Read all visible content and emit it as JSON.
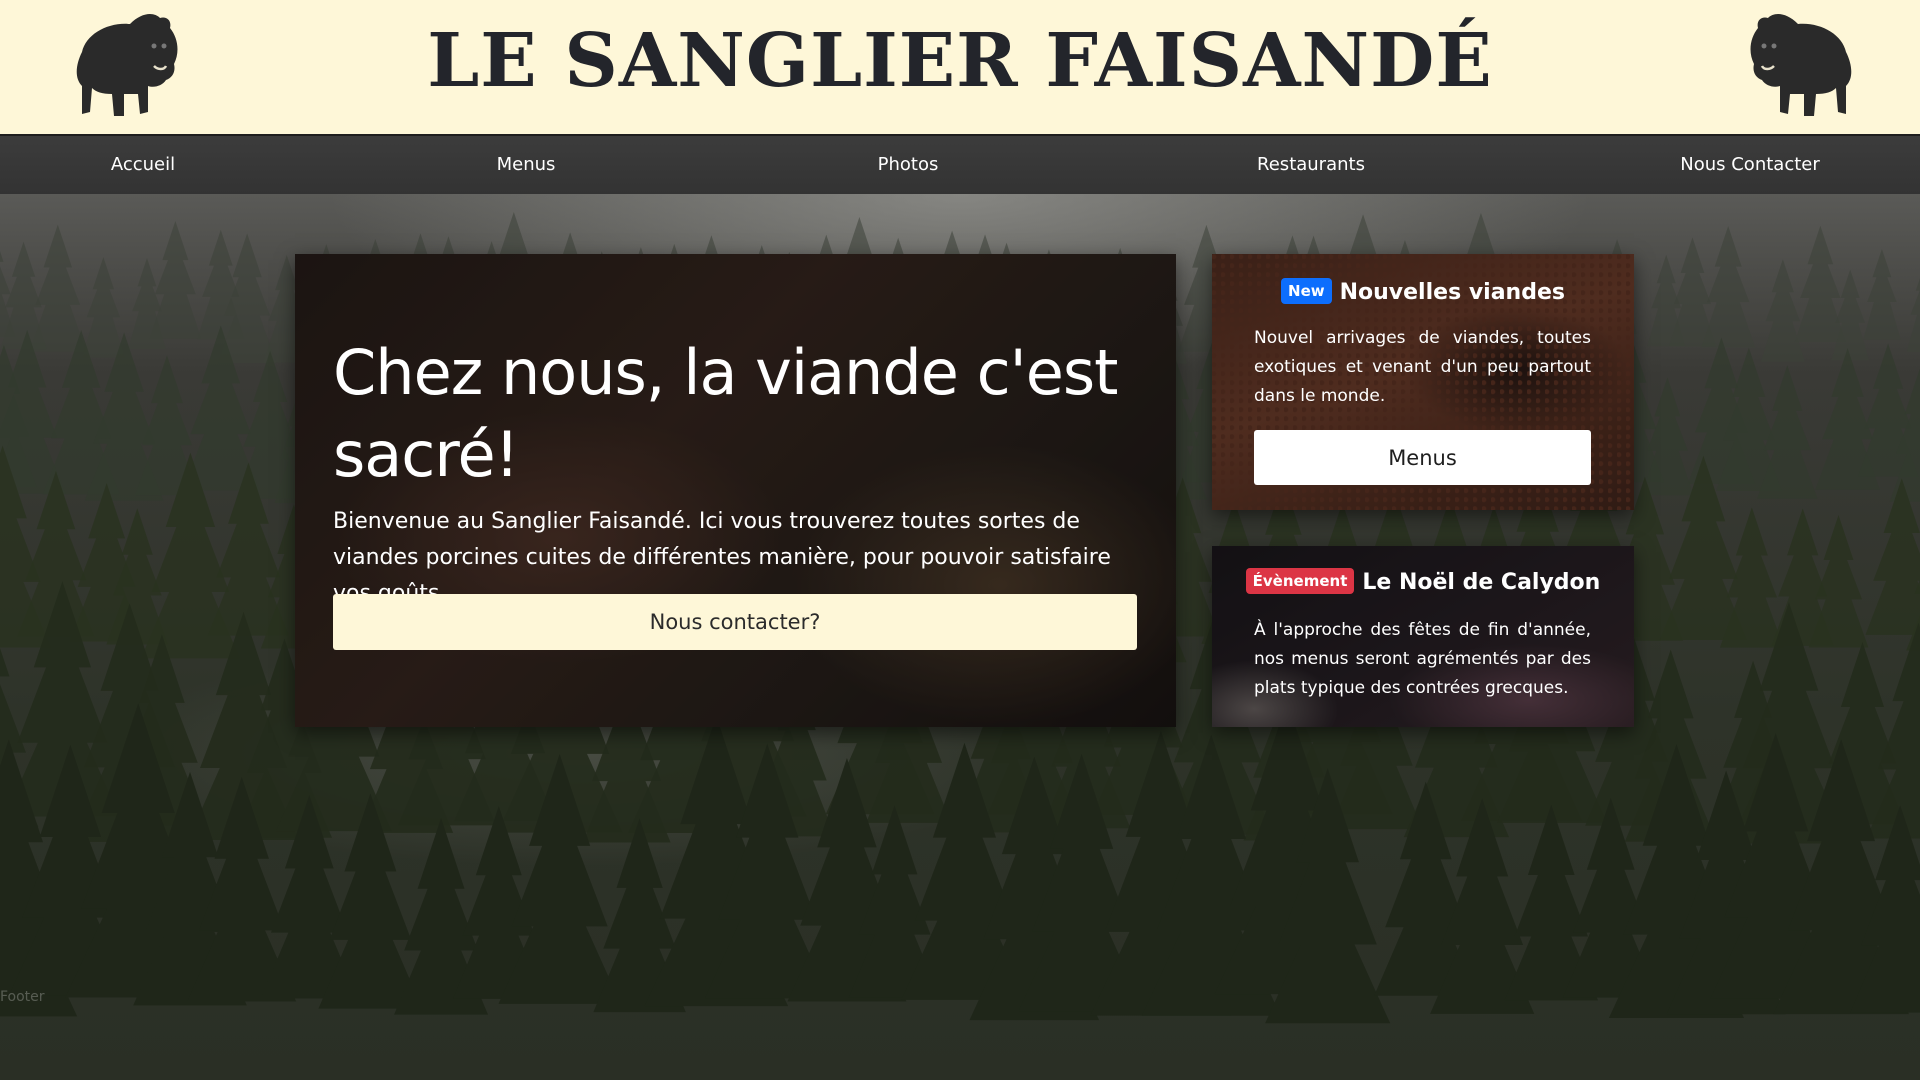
{
  "header": {
    "title": "LE SANGLIER FAISANDÉ",
    "logo_icon": "boar-icon"
  },
  "nav": {
    "items": [
      {
        "label": "Accueil"
      },
      {
        "label": "Menus"
      },
      {
        "label": "Photos"
      },
      {
        "label": "Restaurants"
      },
      {
        "label": "Nous Contacter"
      }
    ]
  },
  "hero": {
    "title": "Chez nous, la viande c'est sacré!",
    "text": "Bienvenue au Sanglier Faisandé. Ici vous trouverez toutes sortes de viandes porcines cuites de différentes manière, pour pouvoir satisfaire vos goûts.",
    "button_label": "Nous contacter?"
  },
  "cards": [
    {
      "badge": "New",
      "badge_color": "#0d6efd",
      "title": "Nouvelles viandes",
      "text": "Nouvel arrivages de viandes, toutes exotiques et venant d'un peu partout dans le monde.",
      "button_label": "Menus"
    },
    {
      "badge": "Évènement",
      "badge_color": "#dc3545",
      "title": "Le Noël de Calydon",
      "text": "À l'approche des fêtes de fin d'année, nos menus seront agrémentés par des plats typique des contrées grecques."
    }
  ],
  "background": {
    "stray_text": "Footer"
  },
  "colors": {
    "header_bg": "#fef7d8",
    "nav_bg": "#333333",
    "title": "#23252b"
  }
}
